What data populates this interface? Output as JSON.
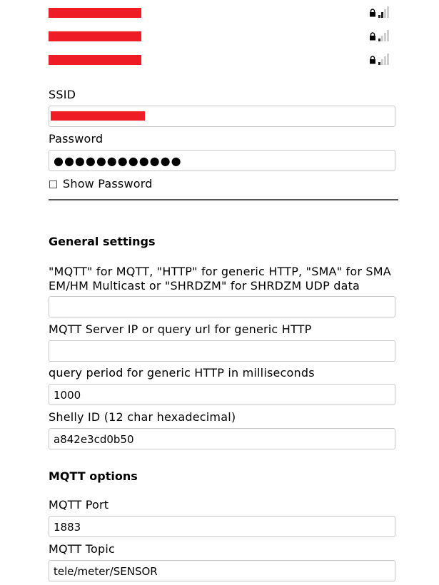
{
  "networks": [
    {
      "name": "",
      "secured": true,
      "signal_bars": 2
    },
    {
      "name": "",
      "secured": true,
      "signal_bars": 1
    },
    {
      "name": "",
      "secured": true,
      "signal_bars": 1
    }
  ],
  "wifi": {
    "ssid_label": "SSID",
    "ssid_value": "",
    "password_label": "Password",
    "password_value": "●●●●●●●●●●●●",
    "show_password_label": "Show Password",
    "show_password_checked": false
  },
  "general": {
    "heading": "General settings",
    "mode_label": "\"MQTT\" for MQTT, \"HTTP\" for generic HTTP, \"SMA\" for SMA EM/HM Multicast or \"SHRDZM\" for SHRDZM UDP data",
    "mode_value": "",
    "server_label": "MQTT Server IP or query url for generic HTTP",
    "server_value": "",
    "period_label": "query period for generic HTTP in milliseconds",
    "period_value": "1000",
    "shelly_label": "Shelly ID (12 char hexadecimal)",
    "shelly_value": "a842e3cd0b50"
  },
  "mqtt": {
    "heading": "MQTT options",
    "port_label": "MQTT Port",
    "port_value": "1883",
    "topic_label": "MQTT Topic",
    "topic_value": "tele/meter/SENSOR"
  },
  "colors": {
    "redaction": "#ee1c25",
    "input_border": "#c8c8c8",
    "divider": "#555555"
  }
}
